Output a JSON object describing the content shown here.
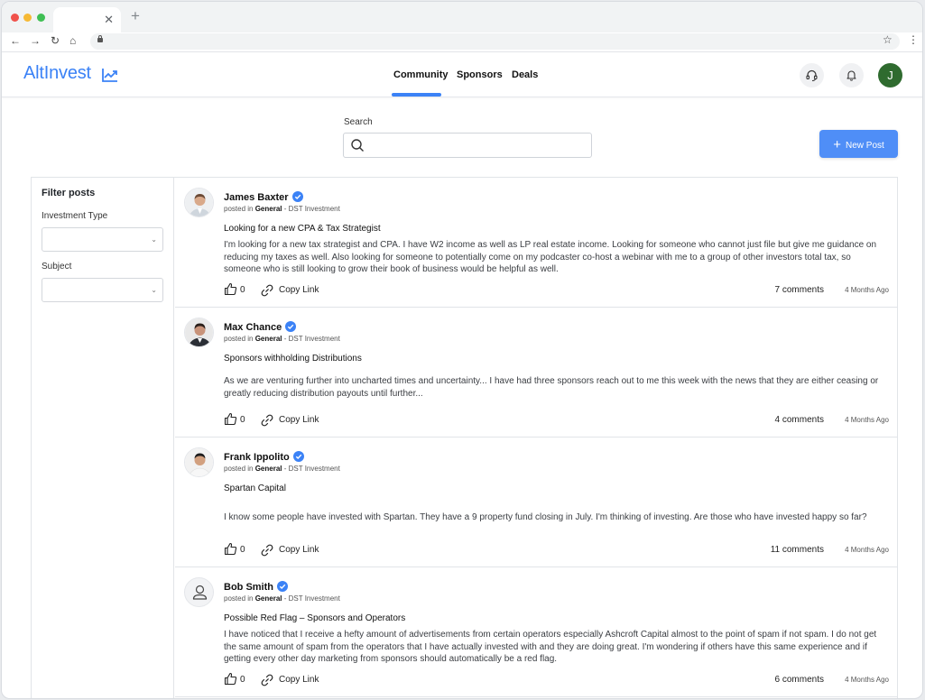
{
  "brand": {
    "name": "AltInvest",
    "accent": "#3b82f6"
  },
  "nav": {
    "items": [
      "Community",
      "Sponsors",
      "Deals"
    ],
    "active": "Community"
  },
  "user": {
    "initial": "J"
  },
  "search": {
    "label": "Search",
    "placeholder": ""
  },
  "new_post": {
    "label": "New Post"
  },
  "filters": {
    "title": "Filter posts",
    "investment_type_label": "Investment Type",
    "subject_label": "Subject"
  },
  "posts": [
    {
      "author": "James Baxter",
      "posted_in_prefix": "posted in",
      "category": "General",
      "tag": "- DST Investment",
      "title": "Looking for a new CPA & Tax Strategist",
      "body": "I'm looking for a new tax strategist and CPA. I have W2 income as well as LP real estate income. Looking for someone who cannot just file but give me guidance on reducing my taxes as well. Also looking for someone to potentially come on my podcaster co-host a webinar with me to a group of other investors total tax, so someone who is still looking to grow their book of business would be helpful as well.",
      "likes": "0",
      "copy_label": "Copy Link",
      "comments": "7 comments",
      "ago": "4 Months Ago"
    },
    {
      "author": "Max Chance",
      "posted_in_prefix": "posted in",
      "category": "General",
      "tag": "- DST Investment",
      "title": "Sponsors withholding Distributions",
      "body": "As we are venturing further into uncharted times and uncertainty... I have had three sponsors reach out to me this week with the news that they are either ceasing or greatly reducing distribution payouts until further...",
      "likes": "0",
      "copy_label": "Copy Link",
      "comments": "4 comments",
      "ago": "4 Months Ago"
    },
    {
      "author": "Frank Ippolito",
      "posted_in_prefix": "posted in",
      "category": "General",
      "tag": "- DST Investment",
      "title": "Spartan Capital",
      "body": "I know some people have invested with Spartan. They have a 9 property fund closing in July. I'm thinking of investing. Are those who have invested happy so far?",
      "likes": "0",
      "copy_label": "Copy Link",
      "comments": "11 comments",
      "ago": "4 Months Ago"
    },
    {
      "author": "Bob Smith",
      "posted_in_prefix": "posted in",
      "category": "General",
      "tag": "- DST Investment",
      "title": "Possible Red Flag – Sponsors and Operators",
      "body": "I have noticed that I receive a hefty amount of advertisements from certain operators especially Ashcroft Capital almost to the point of spam if not spam. I do not get the same amount of spam from the operators that I have actually invested with and they are doing great. I'm wondering if others have this same experience and if getting every other day marketing from sponsors should automatically be a red flag.",
      "likes": "0",
      "copy_label": "Copy Link",
      "comments": "6 comments",
      "ago": "4 Months Ago"
    }
  ]
}
